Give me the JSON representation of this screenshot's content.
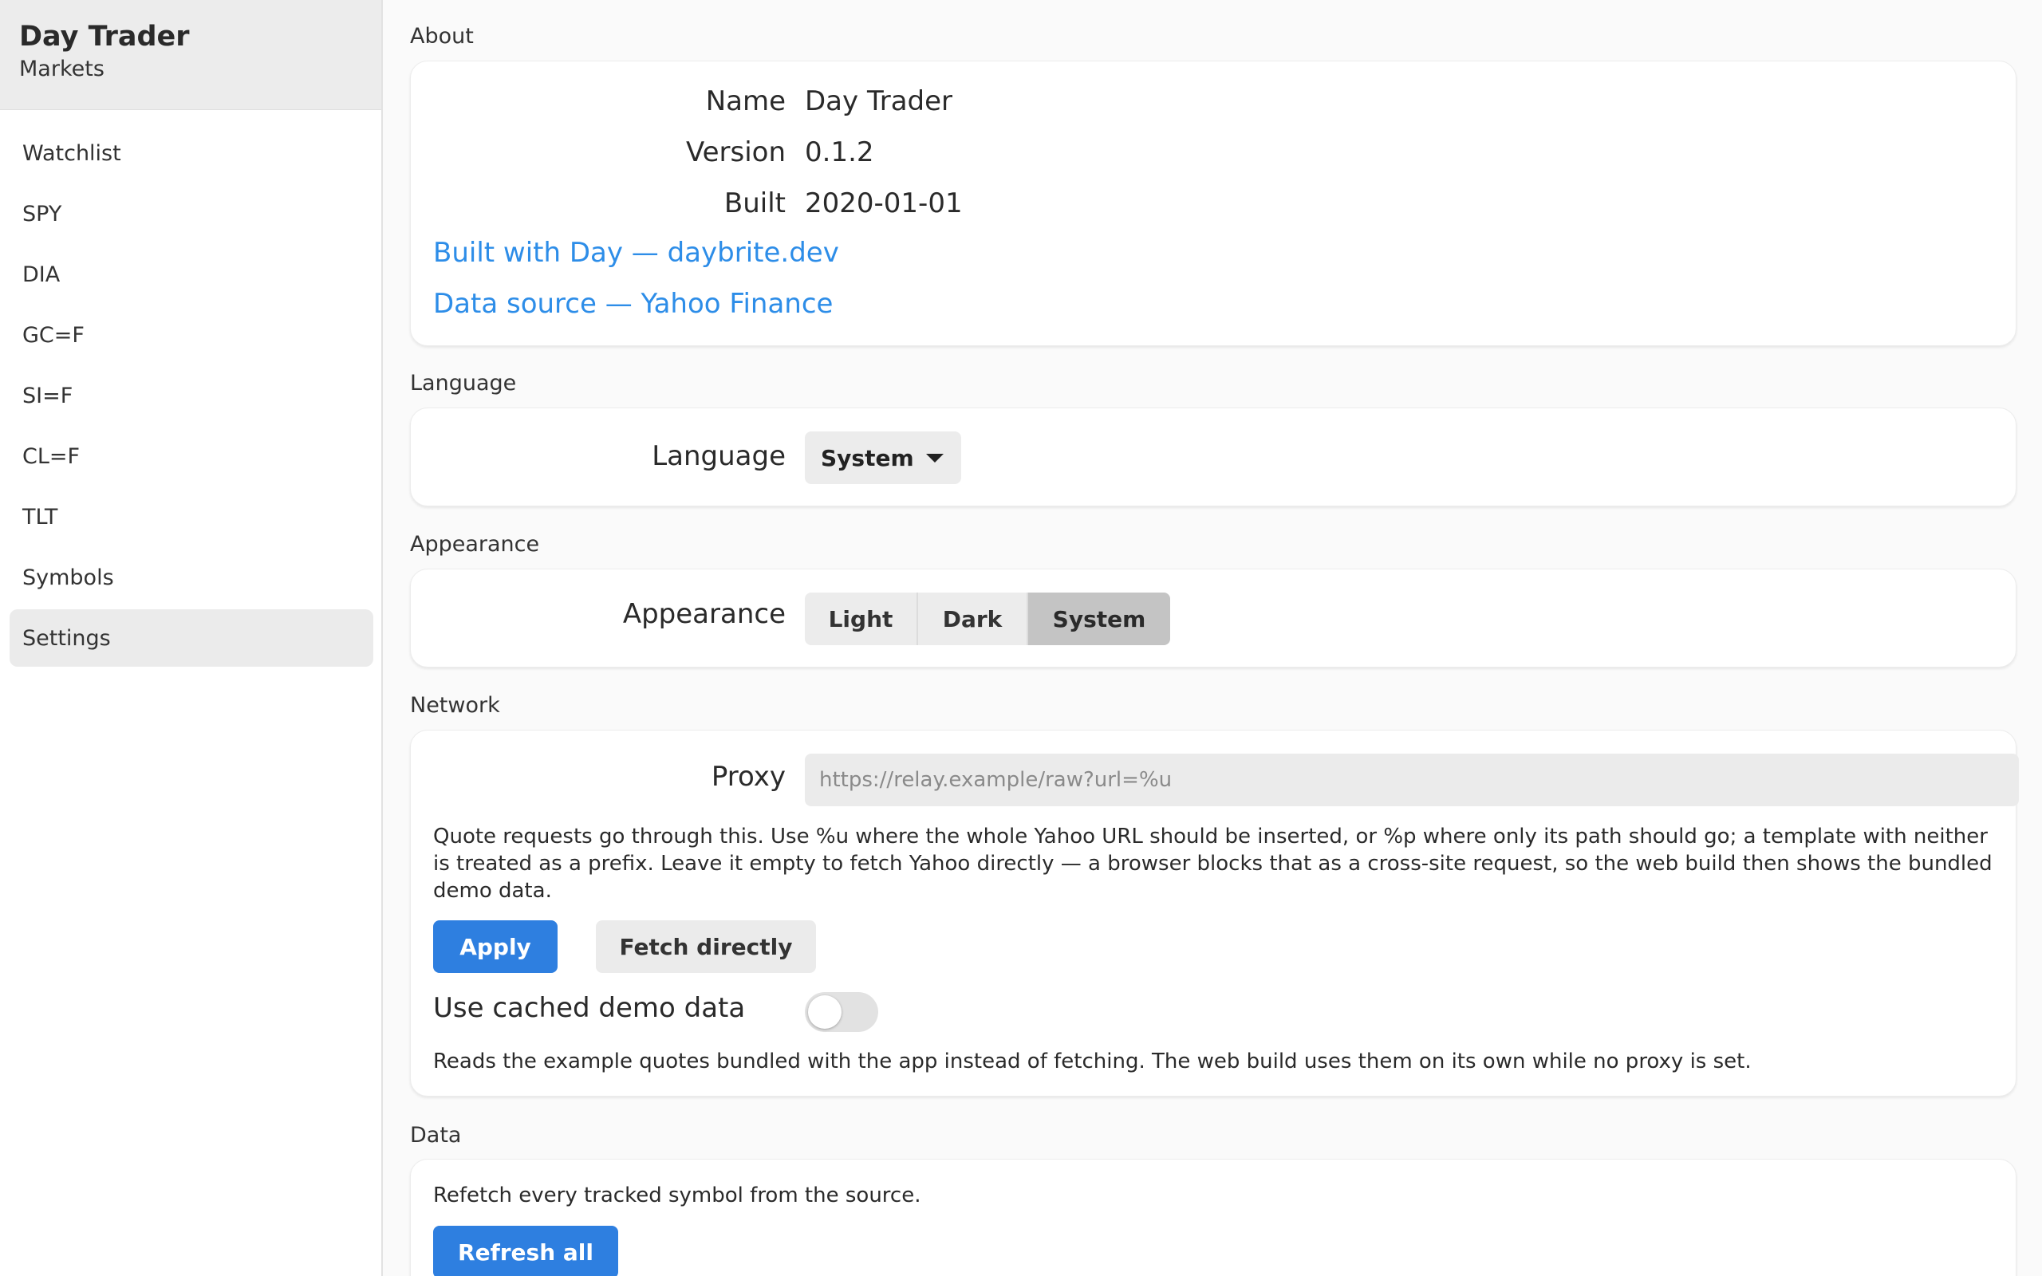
{
  "sidebar": {
    "title": "Day Trader",
    "subtitle": "Markets",
    "items": [
      {
        "label": "Watchlist"
      },
      {
        "label": "SPY"
      },
      {
        "label": "DIA"
      },
      {
        "label": "GC=F"
      },
      {
        "label": "SI=F"
      },
      {
        "label": "CL=F"
      },
      {
        "label": "TLT"
      },
      {
        "label": "Symbols"
      },
      {
        "label": "Settings",
        "active": true
      }
    ]
  },
  "about": {
    "section_label": "About",
    "name_key": "Name",
    "name_value": "Day Trader",
    "version_key": "Version",
    "version_value": "0.1.2",
    "built_key": "Built",
    "built_value": "2020-01-01",
    "link_built_with": "Built with Day — daybrite.dev",
    "link_data_source": "Data source — Yahoo Finance"
  },
  "language": {
    "section_label": "Language",
    "field_label": "Language",
    "selected": "System"
  },
  "appearance": {
    "section_label": "Appearance",
    "field_label": "Appearance",
    "options": [
      "Light",
      "Dark",
      "System"
    ],
    "selected": "System"
  },
  "network": {
    "section_label": "Network",
    "proxy_label": "Proxy",
    "proxy_value": "",
    "proxy_placeholder": "https://relay.example/raw?url=%u",
    "help_text": "Quote requests go through this. Use %u where the whole Yahoo URL should be inserted, or %p where only its path should go; a template with neither is treated as a prefix. Leave it empty to fetch Yahoo directly — a browser blocks that as a cross-site request, so the web build then shows the bundled demo data.",
    "apply_label": "Apply",
    "fetch_directly_label": "Fetch directly",
    "cached_label": "Use cached demo data",
    "cached_enabled": false,
    "cached_help": "Reads the example quotes bundled with the app instead of fetching. The web build uses them on its own while no proxy is set."
  },
  "data_section": {
    "section_label": "Data",
    "help_text": "Refetch every tracked symbol from the source.",
    "refresh_label": "Refresh all"
  }
}
